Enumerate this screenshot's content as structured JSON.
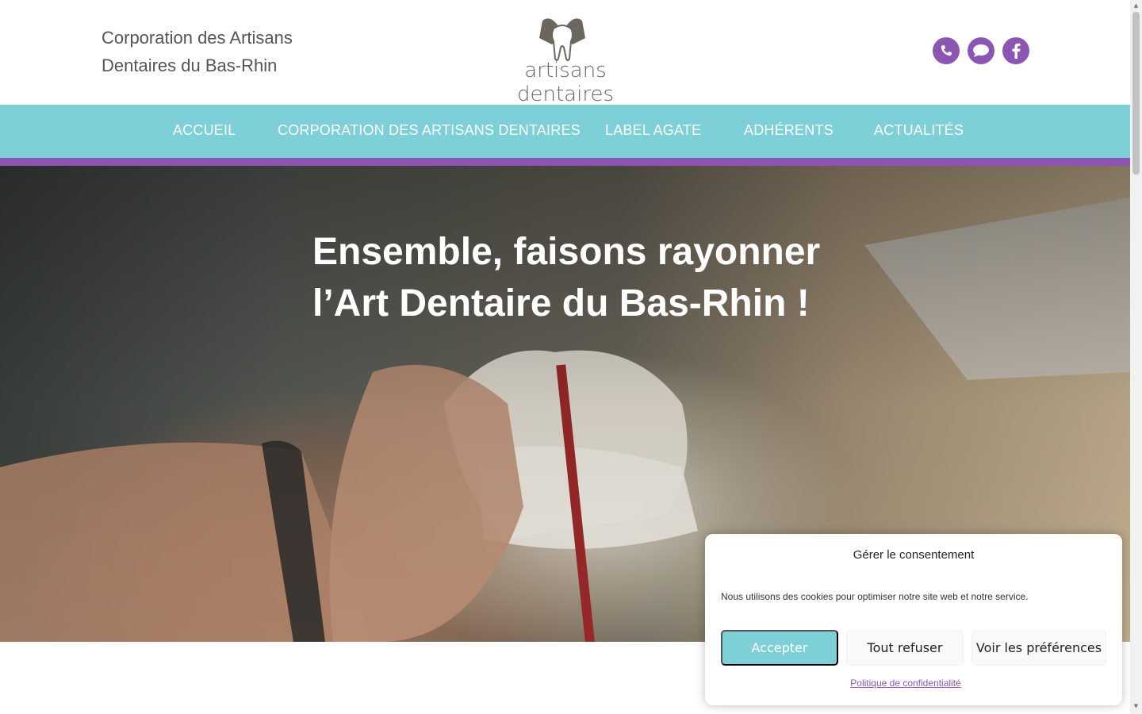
{
  "header": {
    "site_title_line1": "Corporation des Artisans",
    "site_title_line2": "Dentaires du Bas-Rhin",
    "logo_text": "artisans dentaires",
    "social": [
      {
        "name": "phone-icon"
      },
      {
        "name": "chat-icon"
      },
      {
        "name": "facebook-icon"
      }
    ]
  },
  "nav": {
    "items": [
      {
        "label": "ACCUEIL"
      },
      {
        "label": "CORPORATION DES ARTISANS DENTAIRES"
      },
      {
        "label": "LABEL AGATE"
      },
      {
        "label": "ADHÉRENTS"
      },
      {
        "label": "ACTUALITÉS"
      }
    ]
  },
  "hero": {
    "title_line1": "Ensemble, faisons rayonner",
    "title_line2": "l’Art Dentaire du Bas-Rhin !"
  },
  "consent": {
    "title": "Gérer le consentement",
    "message": "Nous utilisons des cookies pour optimiser notre site web et notre service.",
    "accept_label": "Accepter",
    "deny_label": "Tout refuser",
    "prefs_label": "Voir les préférences",
    "policy_link": "Politique de confidentialité"
  },
  "colors": {
    "nav_bg": "#7dd0d7",
    "accent_purple": "#8d55b3",
    "logo_brown": "#6b675e"
  }
}
